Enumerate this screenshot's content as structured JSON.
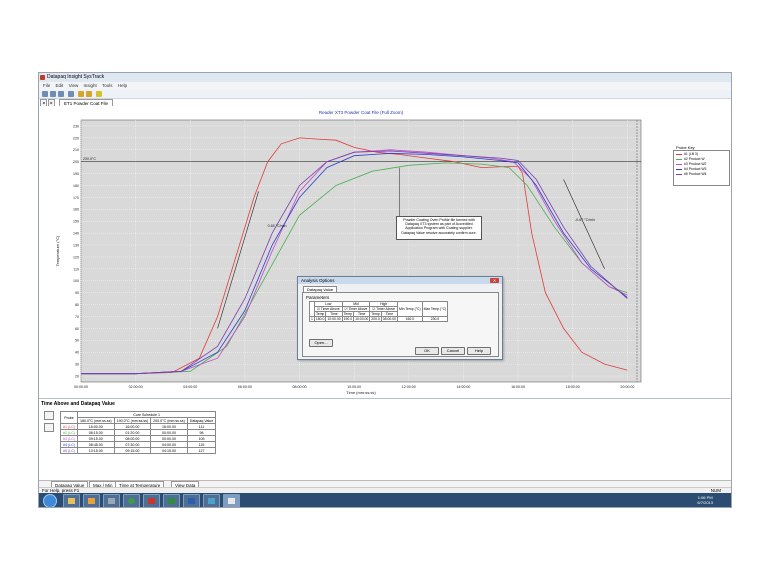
{
  "window": {
    "title": "Datapaq Insight SysTrack"
  },
  "menu": [
    "File",
    "Edit",
    "View",
    "Insight",
    "Tools",
    "Help"
  ],
  "file_tab": "ET1 Powder Coat File",
  "legend": {
    "title": "Probe Key",
    "items": [
      {
        "label": "#1 (LB 3)",
        "color": "#e23b3b"
      },
      {
        "label": "#2 Product W",
        "color": "#4caf50"
      },
      {
        "label": "#3 Product W2",
        "color": "#c04cc7"
      },
      {
        "label": "#4 Product W3",
        "color": "#2c3fcf"
      },
      {
        "label": "#5 Product W4",
        "color": "#7a3fb0"
      }
    ]
  },
  "chart_data": {
    "type": "line",
    "title": "Reader XT3 Powder Coat File (Full Zoom)",
    "xlabel": "Time (mm:ss:ss)",
    "ylabel": "Temperature (°C)",
    "x_ticks": [
      "00:00:00",
      "02:00:00",
      "04:00:00",
      "06:00:00",
      "08:00:00",
      "10:00:00",
      "12:00:00",
      "14:00:00",
      "16:00:00",
      "18:00:00",
      "20:00:00"
    ],
    "y_ticks": [
      20,
      30,
      40,
      50,
      60,
      70,
      80,
      90,
      100,
      110,
      120,
      130,
      140,
      150,
      160,
      170,
      180,
      190,
      200,
      210,
      220,
      230
    ],
    "xlim": [
      0,
      1230
    ],
    "ylim": [
      15,
      235
    ],
    "reference_line": {
      "value": 200,
      "label": "200.0°C"
    },
    "grid": true,
    "series": [
      {
        "name": "#1 (LB 3)",
        "color": "#e23b3b",
        "points": [
          [
            0,
            22
          ],
          [
            120,
            22
          ],
          [
            200,
            23
          ],
          [
            260,
            35
          ],
          [
            300,
            70
          ],
          [
            340,
            120
          ],
          [
            380,
            170
          ],
          [
            410,
            200
          ],
          [
            440,
            215
          ],
          [
            480,
            220
          ],
          [
            520,
            219
          ],
          [
            560,
            218
          ],
          [
            600,
            212
          ],
          [
            650,
            208
          ],
          [
            700,
            206
          ],
          [
            760,
            203
          ],
          [
            820,
            200
          ],
          [
            880,
            195
          ],
          [
            940,
            196
          ],
          [
            960,
            196
          ],
          [
            970,
            190
          ],
          [
            990,
            140
          ],
          [
            1020,
            90
          ],
          [
            1060,
            60
          ],
          [
            1100,
            40
          ],
          [
            1150,
            30
          ],
          [
            1200,
            25
          ]
        ]
      },
      {
        "name": "#2 Product W",
        "color": "#4caf50",
        "points": [
          [
            0,
            22
          ],
          [
            120,
            22
          ],
          [
            240,
            24
          ],
          [
            320,
            45
          ],
          [
            400,
            100
          ],
          [
            480,
            155
          ],
          [
            560,
            180
          ],
          [
            640,
            192
          ],
          [
            720,
            197
          ],
          [
            800,
            199
          ],
          [
            880,
            198
          ],
          [
            940,
            195
          ],
          [
            980,
            180
          ],
          [
            1040,
            145
          ],
          [
            1100,
            115
          ],
          [
            1160,
            95
          ],
          [
            1200,
            90
          ]
        ]
      },
      {
        "name": "#3 Product W2",
        "color": "#c04cc7",
        "points": [
          [
            0,
            22
          ],
          [
            120,
            22
          ],
          [
            220,
            24
          ],
          [
            300,
            35
          ],
          [
            360,
            70
          ],
          [
            420,
            125
          ],
          [
            480,
            175
          ],
          [
            540,
            200
          ],
          [
            600,
            208
          ],
          [
            680,
            210
          ],
          [
            760,
            208
          ],
          [
            840,
            205
          ],
          [
            900,
            203
          ],
          [
            950,
            200
          ],
          [
            990,
            185
          ],
          [
            1040,
            150
          ],
          [
            1100,
            115
          ],
          [
            1160,
            95
          ],
          [
            1200,
            88
          ]
        ]
      },
      {
        "name": "#4 Product W3",
        "color": "#2c3fcf",
        "points": [
          [
            0,
            22
          ],
          [
            120,
            22
          ],
          [
            220,
            24
          ],
          [
            300,
            40
          ],
          [
            360,
            75
          ],
          [
            420,
            130
          ],
          [
            480,
            170
          ],
          [
            540,
            195
          ],
          [
            600,
            205
          ],
          [
            680,
            207
          ],
          [
            760,
            206
          ],
          [
            840,
            204
          ],
          [
            920,
            201
          ],
          [
            960,
            199
          ],
          [
            1000,
            180
          ],
          [
            1060,
            140
          ],
          [
            1120,
            110
          ],
          [
            1200,
            86
          ]
        ]
      },
      {
        "name": "#5 Product W4",
        "color": "#7a3fb0",
        "points": [
          [
            0,
            22
          ],
          [
            120,
            22
          ],
          [
            220,
            24
          ],
          [
            300,
            45
          ],
          [
            360,
            85
          ],
          [
            420,
            140
          ],
          [
            480,
            180
          ],
          [
            540,
            200
          ],
          [
            600,
            208
          ],
          [
            680,
            209
          ],
          [
            760,
            207
          ],
          [
            840,
            205
          ],
          [
            920,
            203
          ],
          [
            960,
            201
          ],
          [
            1000,
            185
          ],
          [
            1060,
            145
          ],
          [
            1120,
            112
          ],
          [
            1200,
            85
          ]
        ]
      }
    ],
    "annotations": [
      {
        "text": "0.65 °C/min",
        "x": 410,
        "y": 145
      },
      {
        "text": "-0.67 °C/min",
        "x": 1085,
        "y": 150
      }
    ]
  },
  "callout": {
    "text": "Powder Coating Oven Profile file formed with Datapaq XT3 system as part of Accredited Application Program with Coating supplier. Datapaq Value resolve accurately confirm cure."
  },
  "dialog": {
    "title": "Analysis Options",
    "tab": "Datapaq Value",
    "section": "Parameters",
    "headers_top": [
      "Low",
      "Mid",
      "High"
    ],
    "checkbox_label": "Timer Above",
    "col_labels": [
      "Temp",
      "Time",
      "Temp",
      "Time",
      "Temp",
      "Time"
    ],
    "extra_headers": [
      "Min Temp (°C)",
      "Max Temp (°C)"
    ],
    "row": [
      "1",
      "180.0",
      "10:00.00",
      "190.0",
      "10:00.00",
      "200.0",
      "08:00.00",
      "160.0",
      "230.0"
    ],
    "open_button": "Open...",
    "ok": "OK",
    "cancel": "Cancel",
    "help": "Help"
  },
  "bottom_panel": {
    "title": "Time Above and Datapaq Value",
    "table": {
      "group_header": "Cure Schedule 1",
      "headers": [
        "Probe",
        "180.0°C (mm:ss.ss)",
        "190.0°C (mm:ss.ss)",
        "200.0°C (mm:ss.ss)",
        "Datapaq Value"
      ],
      "rows": [
        [
          "#1 (LC)",
          "16:00.00",
          "16:00.00",
          "16:00.00",
          "111"
        ],
        [
          "#2 (LC)",
          "08:15.00",
          "01:20.00",
          "00:00.00",
          "98"
        ],
        [
          "#3 (LC)",
          "09:15.00",
          "08:00.00",
          "00:00.00",
          "105"
        ],
        [
          "#4 (LC)",
          "08:45.00",
          "07:30.00",
          "04:00.00",
          "115"
        ],
        [
          "#5 (LC)",
          "10:15.00",
          "09:15.00",
          "04:15.00",
          "127"
        ]
      ],
      "probe_colors": [
        "#e23b3b",
        "#4caf50",
        "#c04cc7",
        "#2c3fcf",
        "#7a3fb0"
      ]
    }
  },
  "sheet_tabs": [
    "Datapaq Value",
    "Max / Min",
    "Time at Temperature",
    "View Data"
  ],
  "status": {
    "left": "For Help, press F1",
    "right": "NUM"
  },
  "clock": {
    "time": "1:06 PM",
    "date": "6/7/2013"
  }
}
